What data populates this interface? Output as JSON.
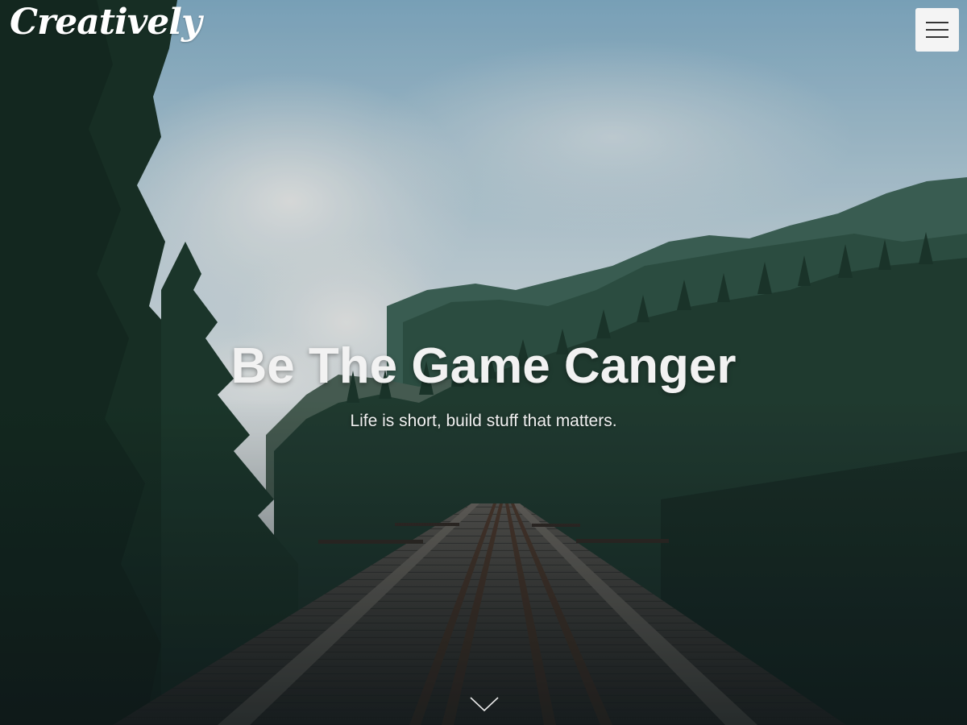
{
  "header": {
    "logo_text": "Creatively",
    "menu_icon": "hamburger-menu-icon"
  },
  "hero": {
    "title": "Be The Game Canger",
    "subtitle": "Life is short, build stuff that matters.",
    "scroll_icon": "chevron-down-icon"
  },
  "colors": {
    "sky_top": "#8fb8d0",
    "sky_haze": "#dfe7ea",
    "forest_dark": "#1f3a30",
    "text_light": "#f2f2f2",
    "menu_bg": "#f4f4f4"
  }
}
